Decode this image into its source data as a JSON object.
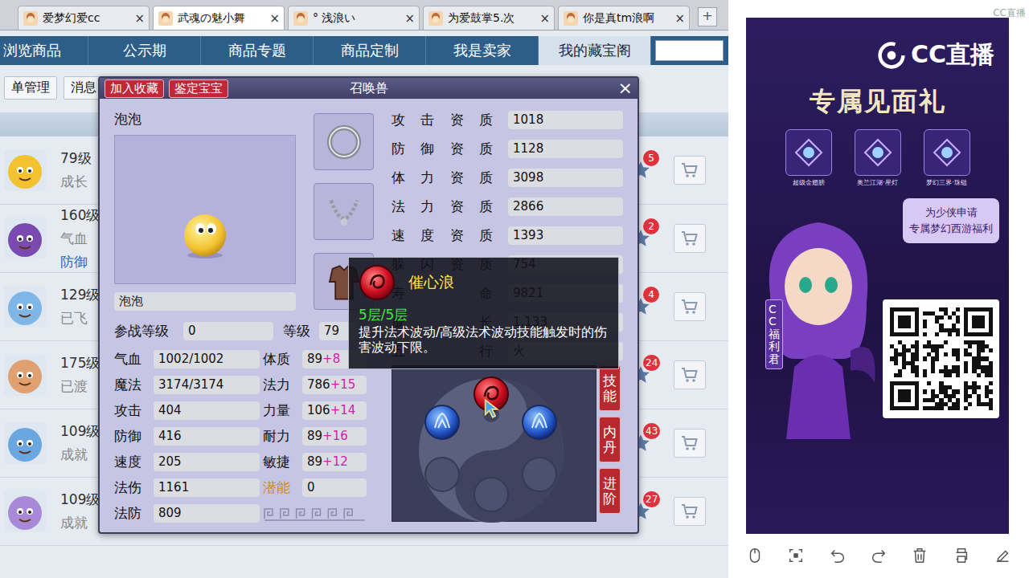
{
  "browser_tabs": [
    {
      "label": "爱梦幻爱cc",
      "selected": false
    },
    {
      "label": "武魂の魅小舞",
      "selected": true
    },
    {
      "label": "° 浅浪い",
      "selected": false
    },
    {
      "label": "为爱鼓掌5.次",
      "selected": false
    },
    {
      "label": "你是真tm浪啊",
      "selected": false
    }
  ],
  "tab_close": "×",
  "new_tab": "+",
  "nav": [
    {
      "label": "浏览商品",
      "selected": false
    },
    {
      "label": "公示期",
      "selected": false
    },
    {
      "label": "商品专题",
      "selected": false
    },
    {
      "label": "商品定制",
      "selected": false
    },
    {
      "label": "我是卖家",
      "selected": false
    },
    {
      "label": "我的藏宝阁",
      "selected": true
    }
  ],
  "subbar": [
    "单管理",
    "消息"
  ],
  "list_rows": [
    {
      "level": "79级",
      "info": [
        "成长"
      ],
      "badge": "5",
      "color": "#f2c230"
    },
    {
      "level": "160级",
      "info": [
        "气血",
        "防御"
      ],
      "badge": "2",
      "color": "#7a4ab0"
    },
    {
      "level": "129级",
      "info": [
        "已飞"
      ],
      "badge": "4",
      "color": "#7fb6e8"
    },
    {
      "level": "175级",
      "info": [
        "已渡"
      ],
      "badge": "24",
      "color": "#e0a070"
    },
    {
      "level": "109级",
      "info": [
        "成就"
      ],
      "badge": "43",
      "color": "#6aa6e0"
    },
    {
      "level": "109级",
      "info": [
        "成就"
      ],
      "badge": "27",
      "color": "#a889d8"
    }
  ],
  "modal": {
    "title": "召唤兽",
    "buttons": [
      "加入收藏",
      "鉴定宝宝"
    ],
    "close": "×",
    "pet_name": "泡泡",
    "name_field": "泡泡",
    "battle_level": {
      "label": "参战等级",
      "value": "0"
    },
    "level": {
      "label": "等级",
      "value": "79"
    },
    "stats": [
      {
        "left": {
          "label": "气血",
          "value": "1002/1002"
        },
        "right": {
          "label": "体质",
          "value": "89",
          "bonus": "+8",
          "highlight": false
        }
      },
      {
        "left": {
          "label": "魔法",
          "value": "3174/3174"
        },
        "right": {
          "label": "法力",
          "value": "786",
          "bonus": "+15",
          "highlight": false
        }
      },
      {
        "left": {
          "label": "攻击",
          "value": "404"
        },
        "right": {
          "label": "力量",
          "value": "106",
          "bonus": "+14",
          "highlight": false
        }
      },
      {
        "left": {
          "label": "防御",
          "value": "416"
        },
        "right": {
          "label": "耐力",
          "value": "89",
          "bonus": "+16",
          "highlight": false
        }
      },
      {
        "left": {
          "label": "速度",
          "value": "205"
        },
        "right": {
          "label": "敏捷",
          "value": "89",
          "bonus": "+12",
          "highlight": false
        }
      },
      {
        "left": {
          "label": "法伤",
          "value": "1161"
        },
        "right": {
          "label": "潜能",
          "value": "0",
          "bonus": "",
          "highlight": true
        }
      },
      {
        "left": {
          "label": "法防",
          "value": "809"
        },
        "right": null
      }
    ],
    "aptitudes": [
      {
        "label": "攻击资质",
        "value": "1018"
      },
      {
        "label": "防御资质",
        "value": "1128"
      },
      {
        "label": "体力资质",
        "value": "3098"
      },
      {
        "label": "法力资质",
        "value": "2866"
      },
      {
        "label": "速度资质",
        "value": "1393"
      },
      {
        "label": "躲闪资质",
        "value": "754"
      },
      {
        "label": "寿命",
        "value": "9821"
      },
      {
        "label": "成长",
        "value": "1.133"
      },
      {
        "label": "五行",
        "value": "火"
      }
    ],
    "skills": [
      {
        "kind": "water",
        "selected": false
      },
      {
        "kind": "fire",
        "selected": true
      },
      {
        "kind": "water",
        "selected": false
      },
      {
        "kind": "empty",
        "selected": false
      },
      {
        "kind": "empty",
        "selected": false
      },
      {
        "kind": "empty",
        "selected": false
      }
    ],
    "side_buttons": [
      "技能",
      "内丹",
      "进阶"
    ]
  },
  "tooltip": {
    "name": "催心浪",
    "layers": "5层/5层",
    "desc": "提升法术波动/高级法术波动技能触发时的伤害波动下限。"
  },
  "watermark": "CC直播",
  "ad": {
    "logo": "CC直播",
    "title": "专属见面礼",
    "items": [
      "超级金翅膀",
      "奥兰江湖·星灯",
      "梦幻三界·珠链"
    ],
    "bubble": [
      "为少侠申请",
      "专属梦幻西游福利"
    ],
    "mascot": "CC福利君"
  }
}
